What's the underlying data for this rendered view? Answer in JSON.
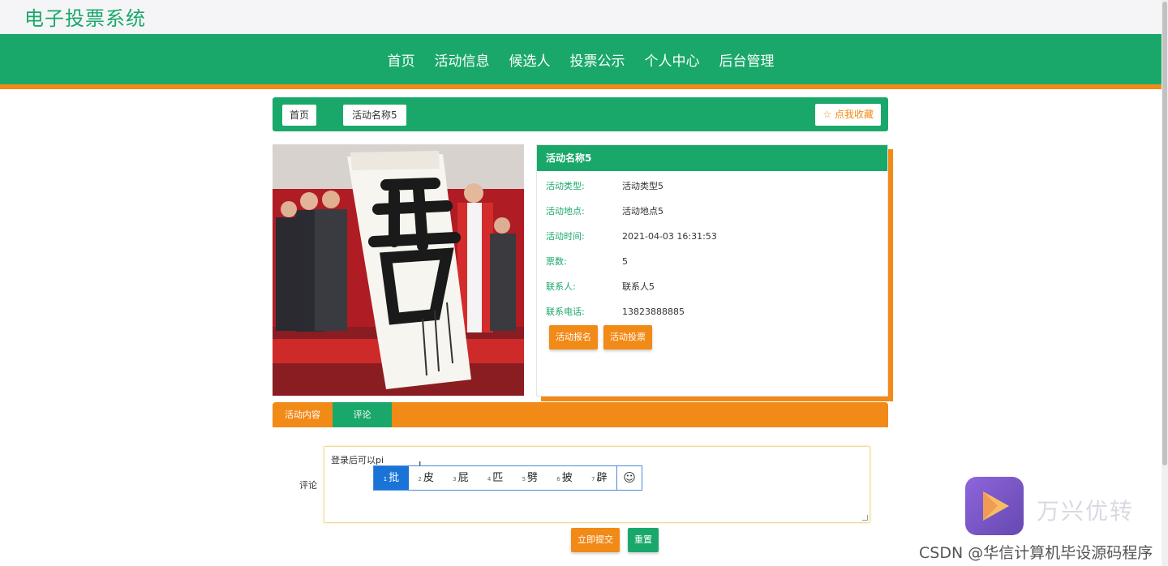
{
  "site": {
    "title": "电子投票系统"
  },
  "nav": [
    "首页",
    "活动信息",
    "候选人",
    "投票公示",
    "个人中心",
    "后台管理"
  ],
  "breadcrumb": {
    "home": "首页",
    "current": "活动名称5",
    "favorite": "☆ 点我收藏"
  },
  "activity": {
    "name": "活动名称5",
    "fields": [
      {
        "label": "活动类型:",
        "value": "活动类型5"
      },
      {
        "label": "活动地点:",
        "value": "活动地点5"
      },
      {
        "label": "活动时间:",
        "value": "2021-04-03 16:31:53"
      },
      {
        "label": "票数:",
        "value": "5"
      },
      {
        "label": "联系人:",
        "value": "联系人5"
      },
      {
        "label": "联系电话:",
        "value": "13823888885"
      }
    ],
    "signup_button": "活动报名",
    "vote_button": "活动投票"
  },
  "tabs": [
    "活动内容",
    "评论"
  ],
  "comment": {
    "label": "评论",
    "typed_text": "登录后可以pi",
    "submit": "立即提交",
    "reset": "重置"
  },
  "ime": {
    "candidates": [
      {
        "num": "1",
        "char": "批"
      },
      {
        "num": "2",
        "char": "皮"
      },
      {
        "num": "3",
        "char": "屁"
      },
      {
        "num": "4",
        "char": "匹"
      },
      {
        "num": "5",
        "char": "劈"
      },
      {
        "num": "6",
        "char": "披"
      },
      {
        "num": "7",
        "char": "辟"
      }
    ],
    "emoji": "☺"
  },
  "overlay": {
    "watermark": "万兴优转",
    "credit": "CSDN @华信计算机毕设源码程序"
  },
  "colors": {
    "primary": "#1aa86a",
    "accent": "#f28a17"
  }
}
